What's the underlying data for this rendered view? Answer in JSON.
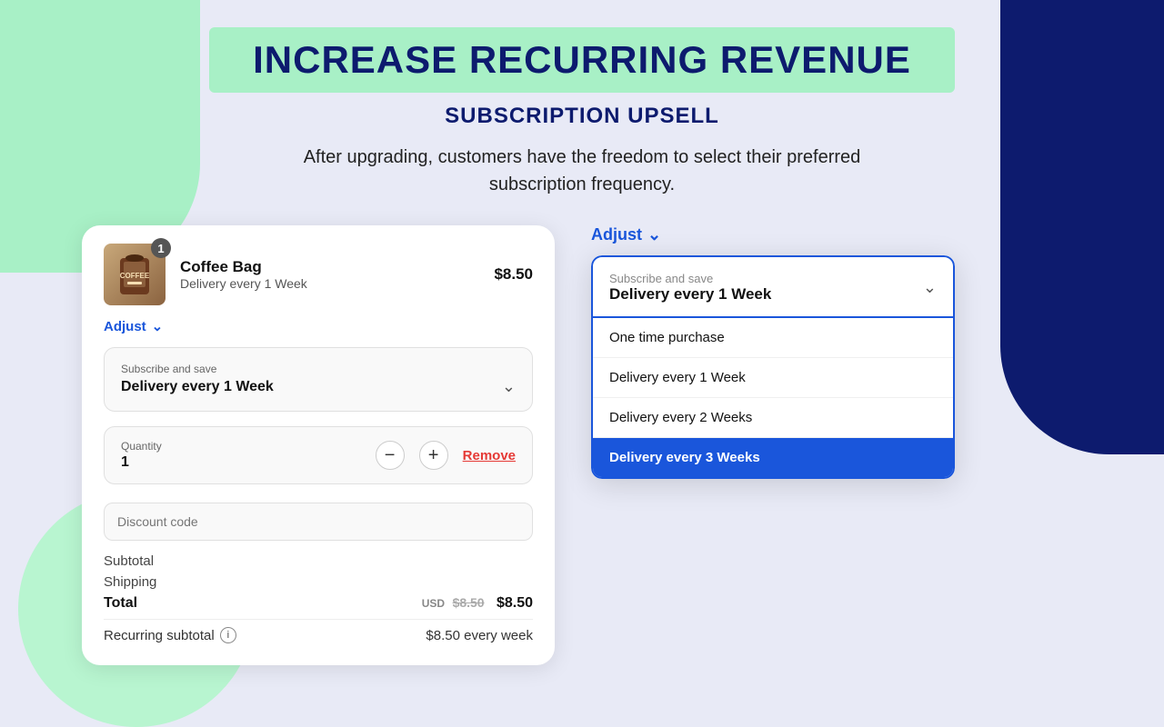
{
  "page": {
    "header": {
      "banner_text": "INCREASE RECURRING REVENUE",
      "subtitle": "SUBSCRIPTION UPSELL",
      "description": "After upgrading, customers have the freedom to select their preferred subscription frequency."
    },
    "left_panel": {
      "item": {
        "name": "Coffee Bag",
        "delivery": "Delivery every 1 Week",
        "price": "$8.50",
        "badge": "1"
      },
      "adjust_label": "Adjust",
      "subscribe_label": "Subscribe and save",
      "subscribe_value": "Delivery every 1 Week",
      "quantity_label": "Quantity",
      "quantity_value": "1",
      "remove_label": "Remove",
      "discount_placeholder": "Discount code",
      "subtotal_label": "Subtotal",
      "shipping_label": "Shipping",
      "total_label": "Total",
      "total_usd": "USD",
      "total_value": "$8.50",
      "total_strikethrough": "$8.50",
      "recurring_label": "Recurring subtotal",
      "recurring_value": "$8.50 every week"
    },
    "right_panel": {
      "adjust_label": "Adjust",
      "dropdown": {
        "header_label": "Subscribe and save",
        "header_value": "Delivery every 1 Week",
        "options": [
          {
            "label": "One time purchase",
            "selected": false
          },
          {
            "label": "Delivery every 1 Week",
            "selected": false
          },
          {
            "label": "Delivery every 2 Weeks",
            "selected": false
          },
          {
            "label": "Delivery every 3 Weeks",
            "selected": true
          }
        ]
      }
    }
  }
}
